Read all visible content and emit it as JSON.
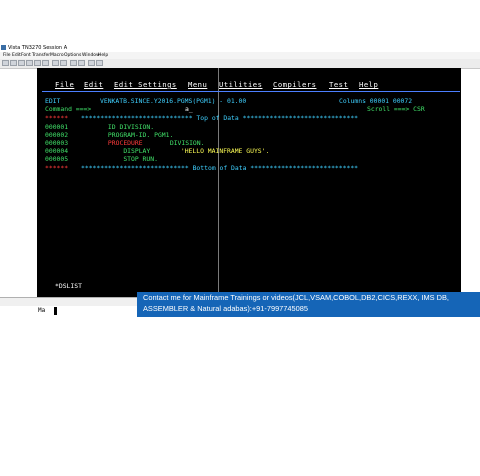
{
  "window": {
    "title": "Vista TN3270 Session A"
  },
  "app_menu": [
    "File",
    "Edit",
    "Font",
    "Transfer",
    "Macro",
    "Options",
    "Window",
    "Help"
  ],
  "terminal": {
    "menu": [
      "File",
      "Edit",
      "Edit_Settings",
      "Menu",
      "Utilities",
      "Compilers",
      "Test",
      "Help"
    ],
    "edit_label": "EDIT",
    "dataset": "VENKATB.SINCE.Y2016.PGMS(PGM1) - 01.00",
    "columns": "Columns 00001 00072",
    "command_label": "Command ===>",
    "command_value": "a_",
    "scroll_label": "Scroll ===> CSR",
    "top_marker": "******",
    "top_line": "***************************** Top of Data ******************************",
    "bottom_line": "**************************** Bottom of Data ****************************",
    "lines": [
      {
        "num": "000001",
        "text": "       ID DIVISION."
      },
      {
        "num": "000002",
        "text": "       PROGRAM-ID. PGM1."
      },
      {
        "num": "000003",
        "kw": "       PROCEDURE",
        "text": " DIVISION."
      },
      {
        "num": "000004",
        "kw": "           DISPLAY",
        "text": " 'HELLO MAINFRAME GUYS'."
      },
      {
        "num": "000005",
        "text": "           STOP RUN."
      }
    ],
    "dslist": "*DSLIST"
  },
  "status": {
    "input_field": "Ma"
  },
  "banner": {
    "line1": "Contact me for Mainframe Trainings or videos(JCL,VSAM,COBOL,DB2,CICS,REXX, IMS DB,",
    "line2": "ASSEMBLER & Natural adabas):+91-7997745085"
  }
}
